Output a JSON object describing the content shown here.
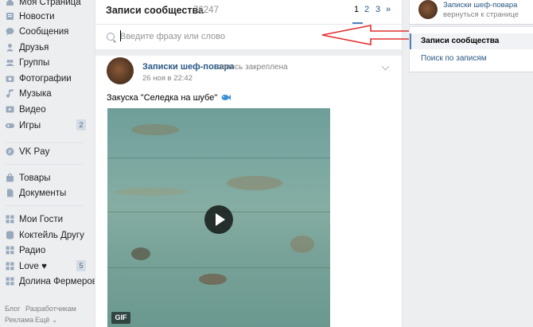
{
  "sidebar": {
    "items": [
      {
        "label": "Моя Страница",
        "icon": "home-icon"
      },
      {
        "label": "Новости",
        "icon": "news-icon"
      },
      {
        "label": "Сообщения",
        "icon": "messages-icon"
      },
      {
        "label": "Друзья",
        "icon": "friends-icon"
      },
      {
        "label": "Группы",
        "icon": "groups-icon"
      },
      {
        "label": "Фотографии",
        "icon": "photos-icon"
      },
      {
        "label": "Музыка",
        "icon": "music-icon"
      },
      {
        "label": "Видео",
        "icon": "video-icon"
      },
      {
        "label": "Игры",
        "icon": "games-icon",
        "count": "2"
      },
      {
        "label": "VK Pay",
        "icon": "vkpay-icon"
      },
      {
        "label": "Товары",
        "icon": "goods-icon"
      },
      {
        "label": "Документы",
        "icon": "documents-icon"
      },
      {
        "label": "Мои Гости",
        "icon": "app-icon"
      },
      {
        "label": "Коктейль Другу",
        "icon": "app-icon"
      },
      {
        "label": "Радио",
        "icon": "app-icon"
      },
      {
        "label": "Love ♥",
        "icon": "app-icon",
        "count": "5"
      },
      {
        "label": "Долина Фермеров",
        "icon": "app-icon"
      }
    ],
    "footer": {
      "blog": "Блог",
      "developers": "Разработчикам",
      "ads": "Реклама",
      "more": "Ещё ⌄"
    }
  },
  "main": {
    "title": "Записи сообщества",
    "count": "76247",
    "pages": [
      "1",
      "2",
      "3",
      "»"
    ],
    "search": {
      "placeholder": "Введите фразу или слово",
      "value": ""
    },
    "post": {
      "author": "Записки шеф-повара",
      "action": "запись закреплена",
      "date": "26 ноя в 22:42",
      "text": "Закуска \"Селедка на шубе\"",
      "media_badge": "GIF"
    }
  },
  "right": {
    "community_name": "Записки шеф-повара",
    "back_link": "вернуться к странице",
    "menu": [
      "Записи сообщества",
      "Поиск по записям"
    ]
  },
  "colors": {
    "link": "#2a5885",
    "accent": "#5181b8",
    "annotation_arrow": "#e03030"
  }
}
